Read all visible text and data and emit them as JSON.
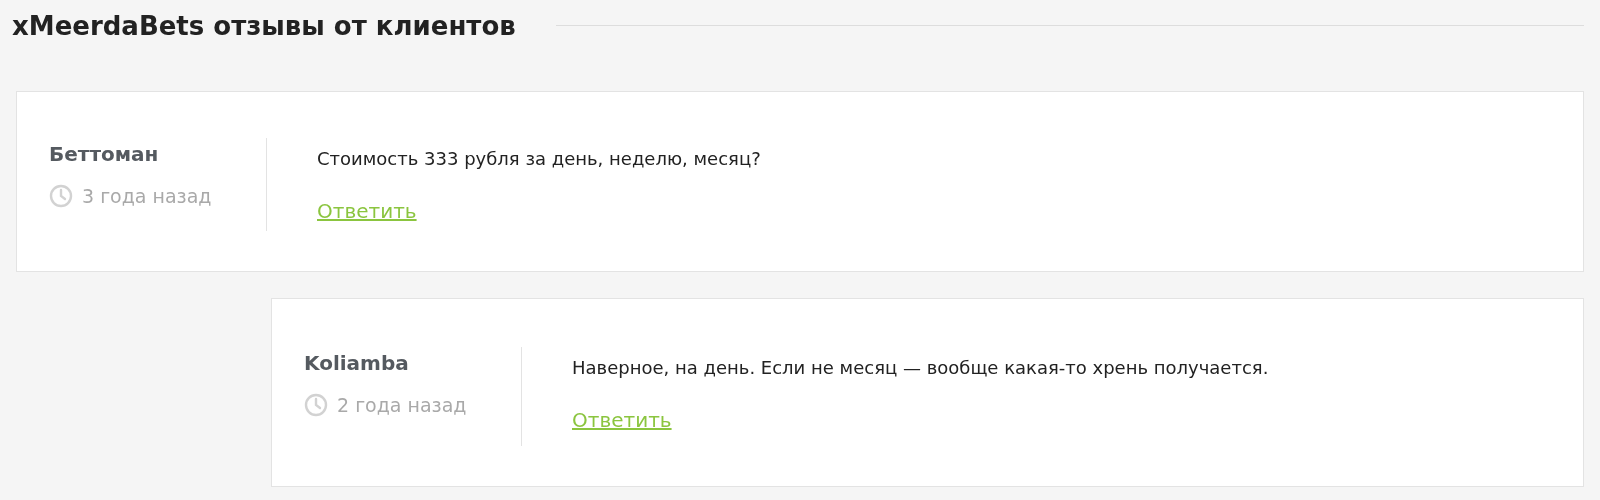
{
  "title": "xMeerdaBets отзывы от клиентов",
  "comments": [
    {
      "author": "Беттоман",
      "time": "3 года назад",
      "text": "Стоимость 333 рубля за день, неделю, месяц?",
      "reply": "Ответить",
      "children": [
        {
          "author": "Koliamba",
          "time": "2 года назад",
          "text": "Наверное, на день. Если не месяц — вообще какая-то хрень получается.",
          "reply": "Ответить"
        }
      ]
    }
  ]
}
